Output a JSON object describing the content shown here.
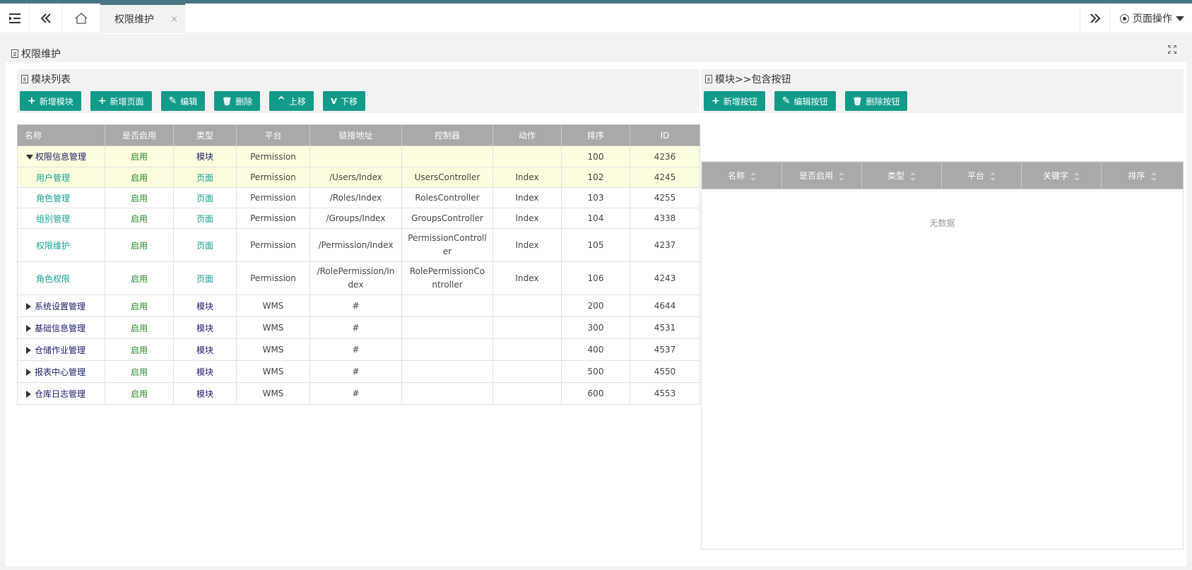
{
  "topbar": {
    "tab_label": "权限维护",
    "tab_close": "×",
    "page_ops_label": "页面操作"
  },
  "page": {
    "title": "权限维护"
  },
  "left_panel": {
    "title": "模块列表",
    "buttons": [
      {
        "icon": "+",
        "label": "新增模块"
      },
      {
        "icon": "+",
        "label": "新增页面"
      },
      {
        "icon": "✎",
        "label": "编辑"
      },
      {
        "icon": "🗑",
        "label": "删除"
      },
      {
        "icon": "^",
        "label": "上移"
      },
      {
        "icon": "v",
        "label": "下移"
      }
    ],
    "columns": [
      "名称",
      "是否启用",
      "类型",
      "平台",
      "链接地址",
      "控制器",
      "动作",
      "排序",
      "ID"
    ],
    "rows": [
      {
        "name": "权限信息管理",
        "enabled": "启用",
        "type": "模块",
        "platform": "Permission",
        "url": "",
        "controller": "",
        "action": "",
        "sort": "100",
        "id": "4236"
      },
      {
        "name": "用户管理",
        "enabled": "启用",
        "type": "页面",
        "platform": "Permission",
        "url": "/Users/Index",
        "controller": "UsersController",
        "action": "Index",
        "sort": "102",
        "id": "4245"
      },
      {
        "name": "角色管理",
        "enabled": "启用",
        "type": "页面",
        "platform": "Permission",
        "url": "/Roles/Index",
        "controller": "RolesController",
        "action": "Index",
        "sort": "103",
        "id": "4255"
      },
      {
        "name": "组别管理",
        "enabled": "启用",
        "type": "页面",
        "platform": "Permission",
        "url": "/Groups/Index",
        "controller": "GroupsController",
        "action": "Index",
        "sort": "104",
        "id": "4338"
      },
      {
        "name": "权限维护",
        "enabled": "启用",
        "type": "页面",
        "platform": "Permission",
        "url": "/Permission/Index",
        "controller": "PermissionController",
        "action": "Index",
        "sort": "105",
        "id": "4237"
      },
      {
        "name": "角色权限",
        "enabled": "启用",
        "type": "页面",
        "platform": "Permission",
        "url": "/RolePermission/Index",
        "controller": "RolePermissionController",
        "action": "Index",
        "sort": "106",
        "id": "4243"
      },
      {
        "name": "系统设置管理",
        "enabled": "启用",
        "type": "模块",
        "platform": "WMS",
        "url": "#",
        "controller": "",
        "action": "",
        "sort": "200",
        "id": "4644"
      },
      {
        "name": "基础信息管理",
        "enabled": "启用",
        "type": "模块",
        "platform": "WMS",
        "url": "#",
        "controller": "",
        "action": "",
        "sort": "300",
        "id": "4531"
      },
      {
        "name": "仓储作业管理",
        "enabled": "启用",
        "type": "模块",
        "platform": "WMS",
        "url": "#",
        "controller": "",
        "action": "",
        "sort": "400",
        "id": "4537"
      },
      {
        "name": "报表中心管理",
        "enabled": "启用",
        "type": "模块",
        "platform": "WMS",
        "url": "#",
        "controller": "",
        "action": "",
        "sort": "500",
        "id": "4550"
      },
      {
        "name": "仓库日志管理",
        "enabled": "启用",
        "type": "模块",
        "platform": "WMS",
        "url": "#",
        "controller": "",
        "action": "",
        "sort": "600",
        "id": "4553"
      }
    ]
  },
  "right_panel": {
    "title": "模块>>包含按钮",
    "buttons": [
      {
        "icon": "+",
        "label": "新增按钮"
      },
      {
        "icon": "✎",
        "label": "编辑按钮"
      },
      {
        "icon": "🗑",
        "label": "删除按钮"
      }
    ],
    "columns": [
      "名称",
      "是否启用",
      "类型",
      "平台",
      "关键字",
      "排序"
    ],
    "empty_text": "无数据"
  }
}
